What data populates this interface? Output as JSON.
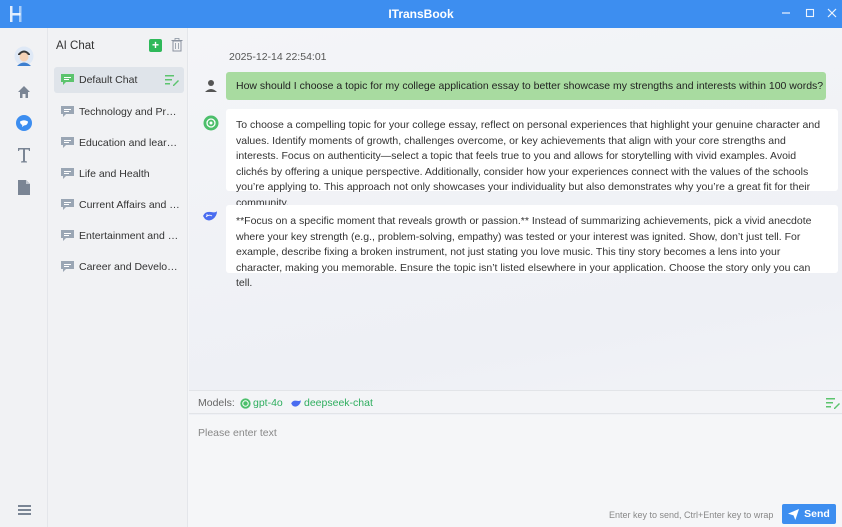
{
  "window": {
    "title": "ITransBook",
    "minimize_icon": "minimize-icon",
    "maximize_icon": "maximize-icon",
    "close_icon": "close-icon",
    "accent_color": "#3d8ef0"
  },
  "rail": {
    "items": [
      {
        "name": "user-avatar",
        "icon": "avatar-icon"
      },
      {
        "name": "home",
        "icon": "home-icon"
      },
      {
        "name": "ai-chat",
        "icon": "chat-bubble-icon",
        "active": true
      },
      {
        "name": "text",
        "icon": "text-t-icon"
      },
      {
        "name": "documents",
        "icon": "document-icon"
      },
      {
        "name": "menu",
        "icon": "list-menu-icon"
      }
    ]
  },
  "chat_panel": {
    "title": "AI Chat",
    "add_icon": "add-icon",
    "delete_icon": "trash-icon",
    "items": [
      {
        "label": "Default Chat",
        "active": true
      },
      {
        "label": "Technology and Progra..."
      },
      {
        "label": "Education and learning"
      },
      {
        "label": "Life and Health"
      },
      {
        "label": "Current Affairs and News"
      },
      {
        "label": "Entertainment and Cultu..."
      },
      {
        "label": "Career and Development"
      }
    ]
  },
  "conversation": {
    "timestamp": "2025-12-14 22:54:01",
    "user_message": "How should I choose a topic for my college application essay to better showcase my strengths and interests within 100 words?",
    "replies": [
      {
        "model": "gpt-4o",
        "text": "To choose a compelling topic for your college essay, reflect on personal experiences that highlight your genuine character and values. Identify moments of growth, challenges overcome, or key achievements that align with your core strengths and interests. Focus on authenticity—select a topic that feels true to you and allows for storytelling with vivid examples. Avoid clichés by offering a unique perspective. Additionally, consider how your experiences connect with the values of the schools you’re applying to. This approach not only showcases your individuality but also demonstrates why you’re a great fit for their community."
      },
      {
        "model": "deepseek-chat",
        "text": "**Focus on a specific moment that reveals growth or passion.** Instead of summarizing achievements, pick a vivid anecdote where your key strength (e.g., problem-solving, empathy) was tested or your interest was ignited. Show, don’t just tell. For example, describe fixing a broken instrument, not just stating you love music. This tiny story becomes a lens into your character, making you memorable. Ensure the topic isn’t listed elsewhere in your application. Choose the story only you can tell."
      }
    ]
  },
  "models_bar": {
    "label": "Models:",
    "models": [
      "gpt-4o",
      "deepseek-chat"
    ],
    "model_color": "#2fae5f"
  },
  "input": {
    "placeholder": "Please enter text",
    "hint": "Enter key to send, Ctrl+Enter key to wrap",
    "send_label": "Send"
  }
}
